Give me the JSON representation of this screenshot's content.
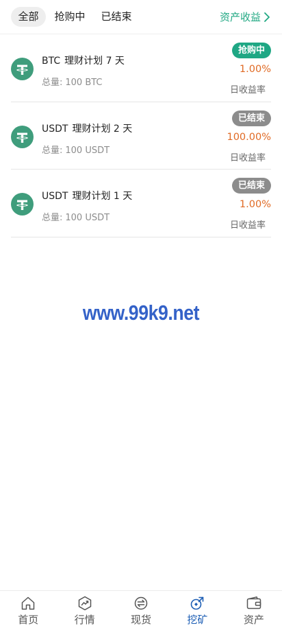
{
  "tabs": [
    {
      "label": "全部",
      "active": true
    },
    {
      "label": "抢购中",
      "active": false
    },
    {
      "label": "已结束",
      "active": false
    }
  ],
  "asset_link": {
    "label": "资产收益",
    "color": "#21a883"
  },
  "plans": [
    {
      "coin": "BTC",
      "title": "理财计划 7 天",
      "total_label": "总量:",
      "total": "100 BTC",
      "status": "抢购中",
      "status_color": "#1fa784",
      "rate": "1.00%",
      "rate_label": "日收益率",
      "icon": "tether-icon"
    },
    {
      "coin": "USDT",
      "title": "理财计划 2 天",
      "total_label": "总量:",
      "total": "100 USDT",
      "status": "已结束",
      "status_color": "#8c8c8c",
      "rate": "100.00%",
      "rate_label": "日收益率",
      "icon": "tether-icon"
    },
    {
      "coin": "USDT",
      "title": "理财计划 1 天",
      "total_label": "总量:",
      "total": "100 USDT",
      "status": "已结束",
      "status_color": "#8c8c8c",
      "rate": "1.00%",
      "rate_label": "日收益率",
      "icon": "tether-icon"
    }
  ],
  "watermark": "www.99k9.net",
  "bottom_nav": [
    {
      "label": "首页",
      "icon": "home-icon",
      "active": false
    },
    {
      "label": "行情",
      "icon": "market-icon",
      "active": false
    },
    {
      "label": "现货",
      "icon": "exchange-icon",
      "active": false
    },
    {
      "label": "挖矿",
      "icon": "mining-icon",
      "active": true
    },
    {
      "label": "资产",
      "icon": "wallet-icon",
      "active": false
    }
  ],
  "colors": {
    "accent": "#1e5fb5",
    "rate": "#e06a24",
    "coin_bg": "#3f9d7c"
  }
}
